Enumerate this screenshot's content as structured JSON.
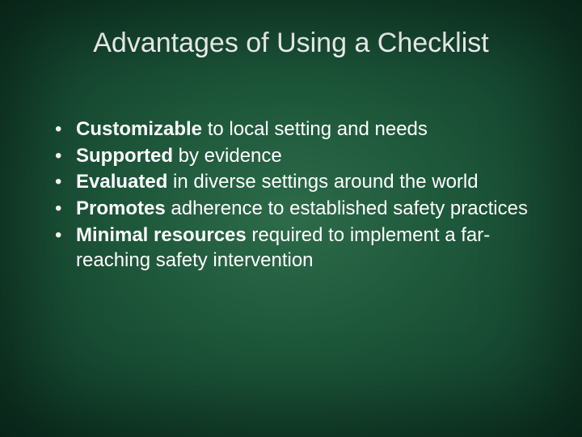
{
  "title": "Advantages of Using a Checklist",
  "bullets": [
    {
      "bold": "Customizable",
      "rest": " to local setting and needs"
    },
    {
      "bold": "Supported",
      "rest": " by evidence"
    },
    {
      "bold": "Evaluated",
      "rest": " in diverse settings around the world"
    },
    {
      "bold": "Promotes",
      "rest": " adherence to established safety practices"
    },
    {
      "bold": "Minimal resources",
      "rest": " required to implement a far-reaching safety intervention"
    }
  ]
}
